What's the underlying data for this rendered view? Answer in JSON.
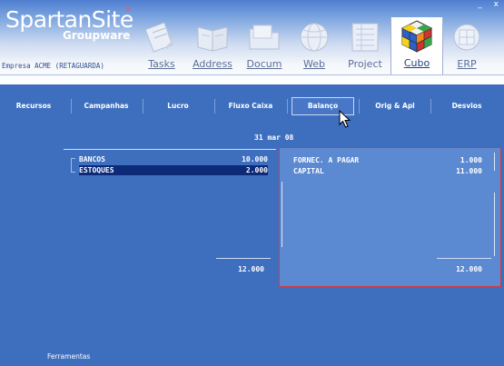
{
  "app": {
    "name": "SpartanSite",
    "registered_mark": "®",
    "subtitle": "Groupware",
    "company": "Empresa ACME (RETAGUARDA)",
    "window_controls": [
      "_",
      "x"
    ]
  },
  "modules": [
    {
      "id": "tasks",
      "label": "Tasks",
      "icon": "tasks-icon",
      "active": false
    },
    {
      "id": "address",
      "label": "Address",
      "icon": "address-book-icon",
      "active": false
    },
    {
      "id": "docum",
      "label": "Docum",
      "icon": "folder-icon",
      "active": false
    },
    {
      "id": "web",
      "label": "Web",
      "icon": "globe-icon",
      "active": false
    },
    {
      "id": "project",
      "label": "Project",
      "icon": "project-icon",
      "active": false
    },
    {
      "id": "cubo",
      "label": "Cubo",
      "icon": "rubiks-cube-icon",
      "active": true
    },
    {
      "id": "erp",
      "label": "ERP",
      "icon": "erp-icon",
      "active": false
    }
  ],
  "tabs": [
    {
      "label": "Recursos",
      "active": false
    },
    {
      "label": "Campanhas",
      "active": false
    },
    {
      "label": "Lucro",
      "active": false
    },
    {
      "label": "Fluxo Caixa",
      "active": false
    },
    {
      "label": "Balanço",
      "active": true
    },
    {
      "label": "Orig & Apl",
      "active": false
    },
    {
      "label": "Desvios",
      "active": false
    }
  ],
  "balance": {
    "date": "31 mar 08",
    "assets": [
      {
        "label": "BANCOS",
        "value": "10.000",
        "selected": false
      },
      {
        "label": "ESTOQUES",
        "value": "2.000",
        "selected": true
      }
    ],
    "assets_total": "12.000",
    "liabilities": [
      {
        "label": "FORNEC. A PAGAR",
        "value": "1.000"
      },
      {
        "label": "CAPITAL",
        "value": "11.000"
      }
    ],
    "liabilities_total": "12.000"
  },
  "footer": {
    "tools_label": "Ferramentas"
  },
  "colors": {
    "background": "#3e6fbf",
    "selected_row": "#0c2a78",
    "highlight_border": "#d23a3a"
  }
}
